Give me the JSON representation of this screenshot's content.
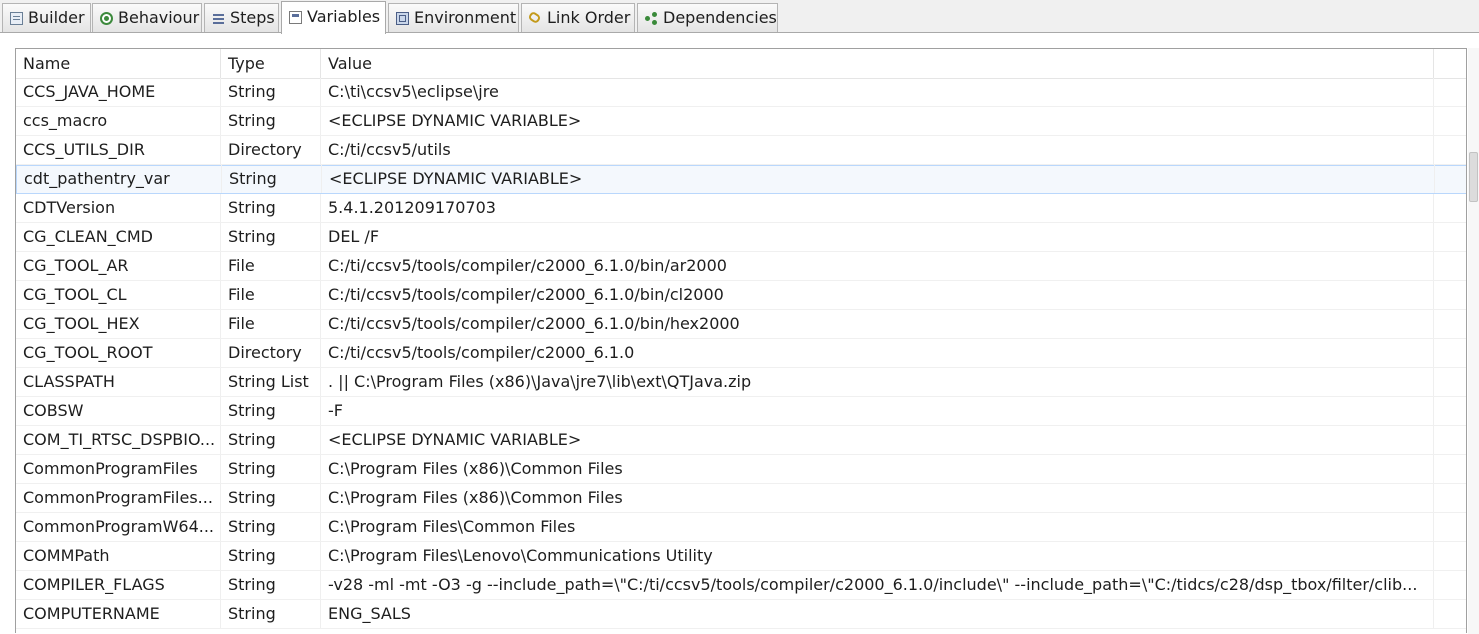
{
  "tabs": [
    {
      "label": "Builder",
      "icon": "builder-icon",
      "active": false
    },
    {
      "label": "Behaviour",
      "icon": "behaviour-icon",
      "active": false
    },
    {
      "label": "Steps",
      "icon": "steps-icon",
      "active": false
    },
    {
      "label": "Variables",
      "icon": "variables-icon",
      "active": true
    },
    {
      "label": "Environment",
      "icon": "environment-icon",
      "active": false
    },
    {
      "label": "Link Order",
      "icon": "link-order-icon",
      "active": false
    },
    {
      "label": "Dependencies",
      "icon": "dependencies-icon",
      "active": false
    }
  ],
  "table": {
    "columns": [
      "Name",
      "Type",
      "Value"
    ],
    "highlighted_row": 3,
    "rows": [
      {
        "name": "CCS_JAVA_HOME",
        "type": "String",
        "value": "C:\\ti\\ccsv5\\eclipse\\jre"
      },
      {
        "name": "ccs_macro",
        "type": "String",
        "value": "<ECLIPSE DYNAMIC VARIABLE>"
      },
      {
        "name": "CCS_UTILS_DIR",
        "type": "Directory",
        "value": "C:/ti/ccsv5/utils"
      },
      {
        "name": "cdt_pathentry_var",
        "type": "String",
        "value": "<ECLIPSE DYNAMIC VARIABLE>"
      },
      {
        "name": "CDTVersion",
        "type": "String",
        "value": "5.4.1.201209170703"
      },
      {
        "name": "CG_CLEAN_CMD",
        "type": "String",
        "value": "DEL /F"
      },
      {
        "name": "CG_TOOL_AR",
        "type": "File",
        "value": "C:/ti/ccsv5/tools/compiler/c2000_6.1.0/bin/ar2000"
      },
      {
        "name": "CG_TOOL_CL",
        "type": "File",
        "value": "C:/ti/ccsv5/tools/compiler/c2000_6.1.0/bin/cl2000"
      },
      {
        "name": "CG_TOOL_HEX",
        "type": "File",
        "value": "C:/ti/ccsv5/tools/compiler/c2000_6.1.0/bin/hex2000"
      },
      {
        "name": "CG_TOOL_ROOT",
        "type": "Directory",
        "value": "C:/ti/ccsv5/tools/compiler/c2000_6.1.0"
      },
      {
        "name": "CLASSPATH",
        "type": "String List",
        "value": ". || C:\\Program Files (x86)\\Java\\jre7\\lib\\ext\\QTJava.zip"
      },
      {
        "name": "COBSW",
        "type": "String",
        "value": "-F"
      },
      {
        "name": "COM_TI_RTSC_DSPBIO...",
        "type": "String",
        "value": "<ECLIPSE DYNAMIC VARIABLE>"
      },
      {
        "name": "CommonProgramFiles",
        "type": "String",
        "value": "C:\\Program Files (x86)\\Common Files"
      },
      {
        "name": "CommonProgramFiles...",
        "type": "String",
        "value": "C:\\Program Files (x86)\\Common Files"
      },
      {
        "name": "CommonProgramW64...",
        "type": "String",
        "value": "C:\\Program Files\\Common Files"
      },
      {
        "name": "COMMPath",
        "type": "String",
        "value": "C:\\Program Files\\Lenovo\\Communications Utility"
      },
      {
        "name": "COMPILER_FLAGS",
        "type": "String",
        "value": "-v28 -ml -mt -O3 -g --include_path=\\\"C:/ti/ccsv5/tools/compiler/c2000_6.1.0/include\\\" --include_path=\\\"C:/tidcs/c28/dsp_tbox/filter/clib..."
      },
      {
        "name": "COMPUTERNAME",
        "type": "String",
        "value": "ENG_SALS"
      }
    ]
  }
}
